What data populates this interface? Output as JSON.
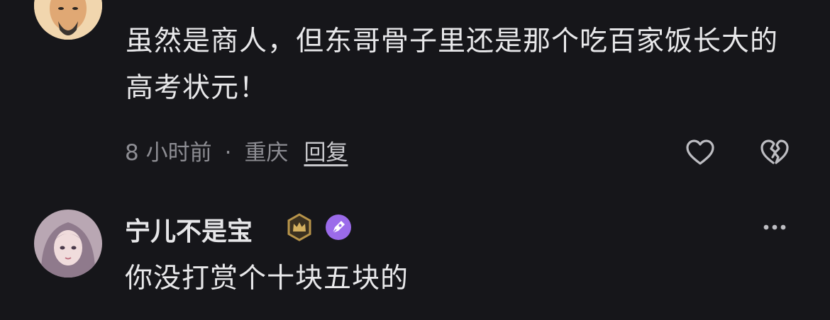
{
  "comments": [
    {
      "avatar_icon": "portrait-avatar-icon",
      "text": "虽然是商人，但东哥骨子里还是那个吃百家饭长大的高考状元！",
      "time": "8 小时前",
      "separator": "·",
      "location": "重庆",
      "reply_label": "回复",
      "like_icon": "heart-outline-icon",
      "dislike_icon": "broken-heart-icon"
    },
    {
      "avatar_icon": "anime-girl-avatar-icon",
      "username": "宁儿不是宝",
      "badges": [
        "crown-badge-icon",
        "pen-badge-icon"
      ],
      "more_icon": "more-dots-icon",
      "text": "你没打赏个十块五块的"
    }
  ],
  "colors": {
    "background": "#16161a",
    "text": "#e8e8ea",
    "meta": "#8d8d93",
    "badge_gold": "#b8944a",
    "badge_purple": "#9b6bea"
  }
}
